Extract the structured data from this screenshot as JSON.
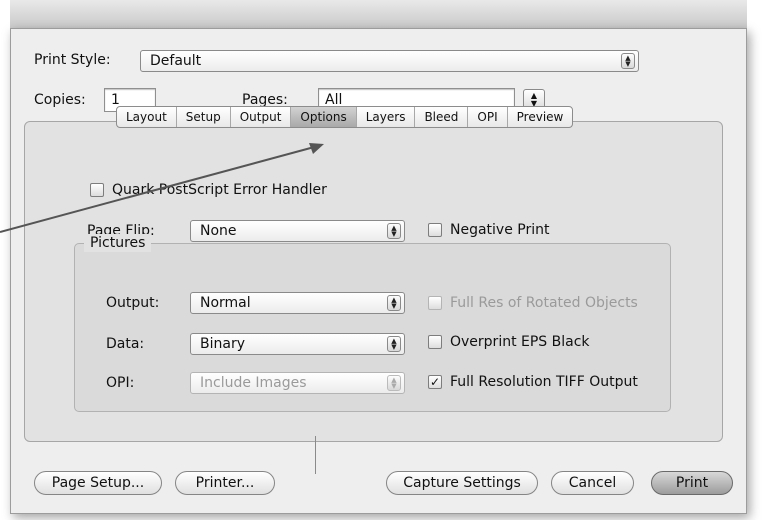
{
  "print_style": {
    "label": "Print Style:",
    "value": "Default"
  },
  "copies": {
    "label": "Copies:",
    "value": "1"
  },
  "pages": {
    "label": "Pages:",
    "value": "All"
  },
  "tabs": [
    {
      "label": "Layout",
      "selected": false
    },
    {
      "label": "Setup",
      "selected": false
    },
    {
      "label": "Output",
      "selected": false
    },
    {
      "label": "Options",
      "selected": true
    },
    {
      "label": "Layers",
      "selected": false
    },
    {
      "label": "Bleed",
      "selected": false
    },
    {
      "label": "OPI",
      "selected": false
    },
    {
      "label": "Preview",
      "selected": false
    }
  ],
  "options": {
    "error_handler": {
      "label": "Quark PostScript Error Handler",
      "checked": false
    },
    "page_flip": {
      "label": "Page Flip:",
      "value": "None"
    },
    "negative_print": {
      "label": "Negative Print",
      "checked": false
    }
  },
  "pictures": {
    "title": "Pictures",
    "output": {
      "label": "Output:",
      "value": "Normal"
    },
    "data": {
      "label": "Data:",
      "value": "Binary"
    },
    "opi": {
      "label": "OPI:",
      "value": "Include Images",
      "enabled": false
    },
    "full_res_rotated": {
      "label": "Full Res of Rotated Objects",
      "checked": false,
      "enabled": false
    },
    "overprint_eps": {
      "label": "Overprint EPS Black",
      "checked": false
    },
    "full_res_tiff": {
      "label": "Full Resolution TIFF Output",
      "checked": true
    }
  },
  "buttons": {
    "page_setup": "Page Setup...",
    "printer": "Printer...",
    "capture_settings": "Capture Settings",
    "cancel": "Cancel",
    "print": "Print"
  },
  "glyphs": {
    "check": "✓",
    "arrows_up": "▲",
    "arrows_down": "▼"
  }
}
